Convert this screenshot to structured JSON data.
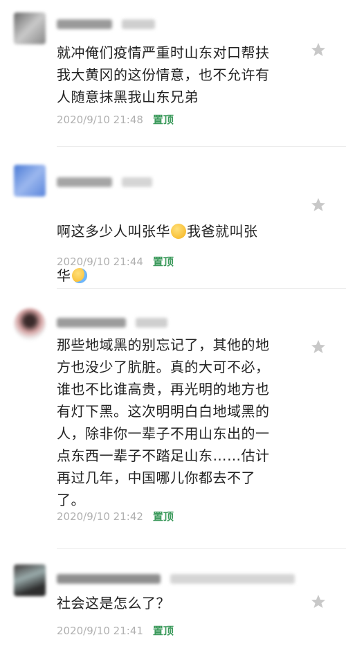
{
  "comments": [
    {
      "text": "就冲俺们疫情严重时山东对口帮扶\n我大黄冈的这份情意，也不允许有\n人随意抹黑我山东兄弟",
      "timestamp": "2020/9/10 21:48",
      "pin_label": "置顶"
    },
    {
      "text_part1": "啊这多少人叫张华",
      "text_part2": "我爸就叫张",
      "text_part3": "华",
      "timestamp": "2020/9/10 21:44",
      "pin_label": "置顶"
    },
    {
      "text": "那些地域黑的别忘记了，其他的地\n方也没少了肮脏。真的大可不必，\n谁也不比谁高贵，再光明的地方也\n有灯下黑。这次明明白白地域黑的\n人，除非你一辈子不用山东出的一\n点东西一辈子不踏足山东……估计\n再过几年，中国哪儿你都去不了\n了。",
      "timestamp": "2020/9/10 21:42",
      "pin_label": "置顶"
    },
    {
      "text": "社会这是怎么了？",
      "timestamp": "2020/9/10 21:41",
      "pin_label": "置顶"
    }
  ],
  "colors": {
    "pin": "#3c9a5c",
    "timestamp": "#b0b0b0",
    "star": "#c8c8c8"
  },
  "icons": {
    "star": "star-icon",
    "emoji_1": "grimacing-face-emoji",
    "emoji_2": "crying-face-emoji"
  }
}
